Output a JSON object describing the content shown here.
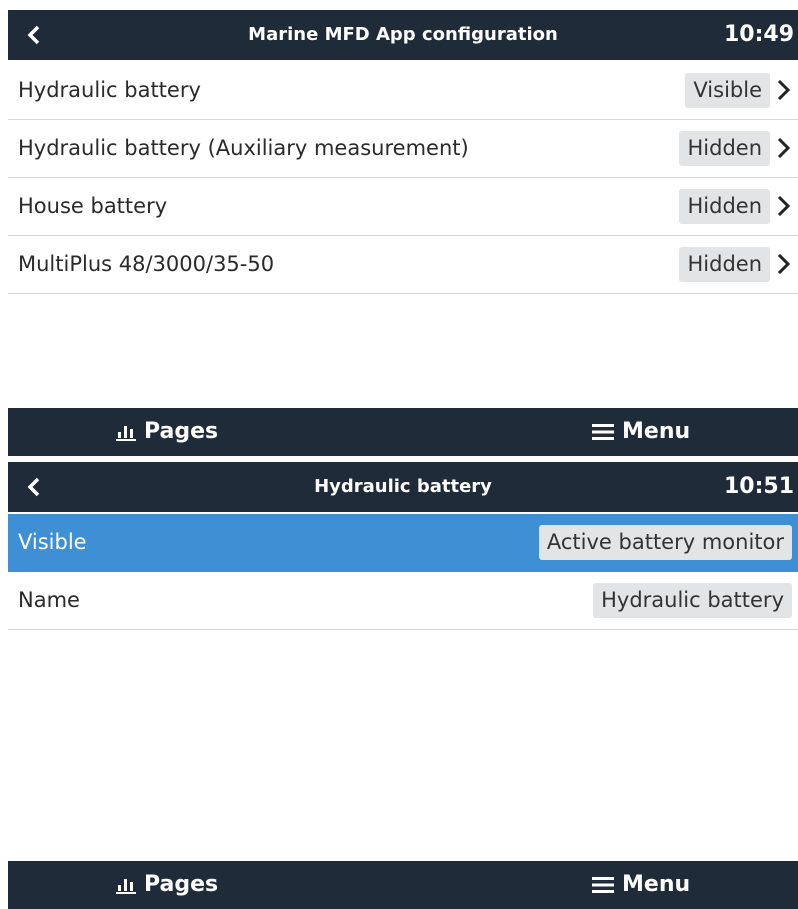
{
  "screen1": {
    "header": {
      "title": "Marine MFD App configuration",
      "time": "10:49"
    },
    "rows": [
      {
        "label": "Hydraulic battery",
        "value": "Visible"
      },
      {
        "label": "Hydraulic battery (Auxiliary measurement)",
        "value": "Hidden"
      },
      {
        "label": "House battery",
        "value": "Hidden"
      },
      {
        "label": "MultiPlus 48/3000/35-50",
        "value": "Hidden"
      }
    ],
    "footer": {
      "pages_label": "Pages",
      "menu_label": "Menu"
    }
  },
  "screen2": {
    "header": {
      "title": "Hydraulic battery",
      "time": "10:51"
    },
    "rows": [
      {
        "label": "Visible",
        "value": "Active battery monitor"
      },
      {
        "label": "Name",
        "value": "Hydraulic battery"
      }
    ],
    "footer": {
      "pages_label": "Pages",
      "menu_label": "Menu"
    }
  },
  "colors": {
    "header_bg": "#1f2b38",
    "selected_row": "#3e8fd4",
    "value_pill": "#e2e4e6"
  },
  "icons": [
    "back-arrow-icon",
    "chevron-right-icon",
    "bar-chart-icon",
    "hamburger-menu-icon"
  ]
}
